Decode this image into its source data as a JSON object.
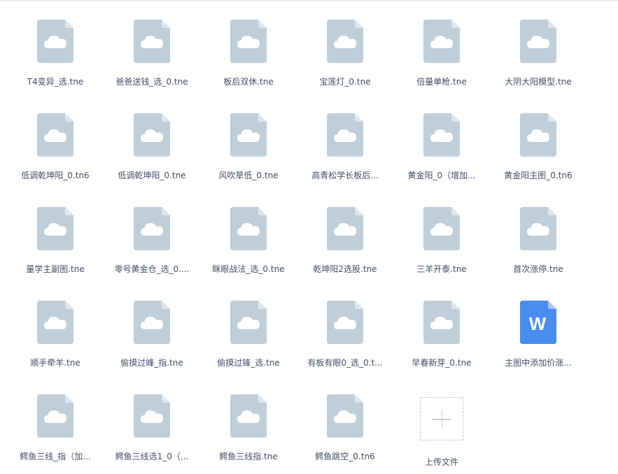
{
  "files": [
    {
      "name": "T4变异_选.tne",
      "icon": "cloud-file-icon",
      "type": "generic"
    },
    {
      "name": "爸爸送钱_选_0.tne",
      "icon": "cloud-file-icon",
      "type": "generic"
    },
    {
      "name": "板后双休.tne",
      "icon": "cloud-file-icon",
      "type": "generic"
    },
    {
      "name": "宝莲灯_0.tne",
      "icon": "cloud-file-icon",
      "type": "generic"
    },
    {
      "name": "倍量单枪.tne",
      "icon": "cloud-file-icon",
      "type": "generic"
    },
    {
      "name": "大阴大阳模型.tne",
      "icon": "cloud-file-icon",
      "type": "generic"
    },
    {
      "name": "低调乾坤阳_0.tn6",
      "icon": "cloud-file-icon",
      "type": "generic"
    },
    {
      "name": "低调乾坤阳_0.tne",
      "icon": "cloud-file-icon",
      "type": "generic"
    },
    {
      "name": "风吹草低_0.tne",
      "icon": "cloud-file-icon",
      "type": "generic"
    },
    {
      "name": "高青松学长板后...",
      "icon": "cloud-file-icon",
      "type": "generic"
    },
    {
      "name": "黄金阳_0（增加...",
      "icon": "cloud-file-icon",
      "type": "generic"
    },
    {
      "name": "黄金阳主图_0.tn6",
      "icon": "cloud-file-icon",
      "type": "generic"
    },
    {
      "name": "量学主副图.tne",
      "icon": "cloud-file-icon",
      "type": "generic"
    },
    {
      "name": "零号黄金仓_选_0....",
      "icon": "cloud-file-icon",
      "type": "generic"
    },
    {
      "name": "眯眼战法_选_0.tne",
      "icon": "cloud-file-icon",
      "type": "generic"
    },
    {
      "name": "乾坤阳2选股.tne",
      "icon": "cloud-file-icon",
      "type": "generic"
    },
    {
      "name": "三羊开泰.tne",
      "icon": "cloud-file-icon",
      "type": "generic"
    },
    {
      "name": "首次涨停.tne",
      "icon": "cloud-file-icon",
      "type": "generic"
    },
    {
      "name": "顺手牵羊.tne",
      "icon": "cloud-file-icon",
      "type": "generic"
    },
    {
      "name": "偷摸过峰_指.tne",
      "icon": "cloud-file-icon",
      "type": "generic"
    },
    {
      "name": "偷摸过锋_选.tne",
      "icon": "cloud-file-icon",
      "type": "generic"
    },
    {
      "name": "有板有眼0_选_0.t...",
      "icon": "cloud-file-icon",
      "type": "generic"
    },
    {
      "name": "早春新芽_0.tne",
      "icon": "cloud-file-icon",
      "type": "generic"
    },
    {
      "name": "主图中添加价涨...",
      "icon": "word-doc-icon",
      "type": "word",
      "badge": "W"
    },
    {
      "name": "鳄鱼三线_指（加...",
      "icon": "cloud-file-icon",
      "type": "generic"
    },
    {
      "name": "鳄鱼三线选1_0（...",
      "icon": "cloud-file-icon",
      "type": "generic"
    },
    {
      "name": "鳄鱼三线指.tne",
      "icon": "cloud-file-icon",
      "type": "generic"
    },
    {
      "name": "鳄鱼跳空_0.tn6",
      "icon": "cloud-file-icon",
      "type": "generic"
    }
  ],
  "upload": {
    "label": "上传文件",
    "icon": "plus-icon"
  },
  "colors": {
    "generic_file": "#bfcdd8",
    "generic_fold": "#dfe6ec",
    "word_file": "#4a8df0",
    "word_fold": "#a9c9f7",
    "text": "#424e67"
  }
}
